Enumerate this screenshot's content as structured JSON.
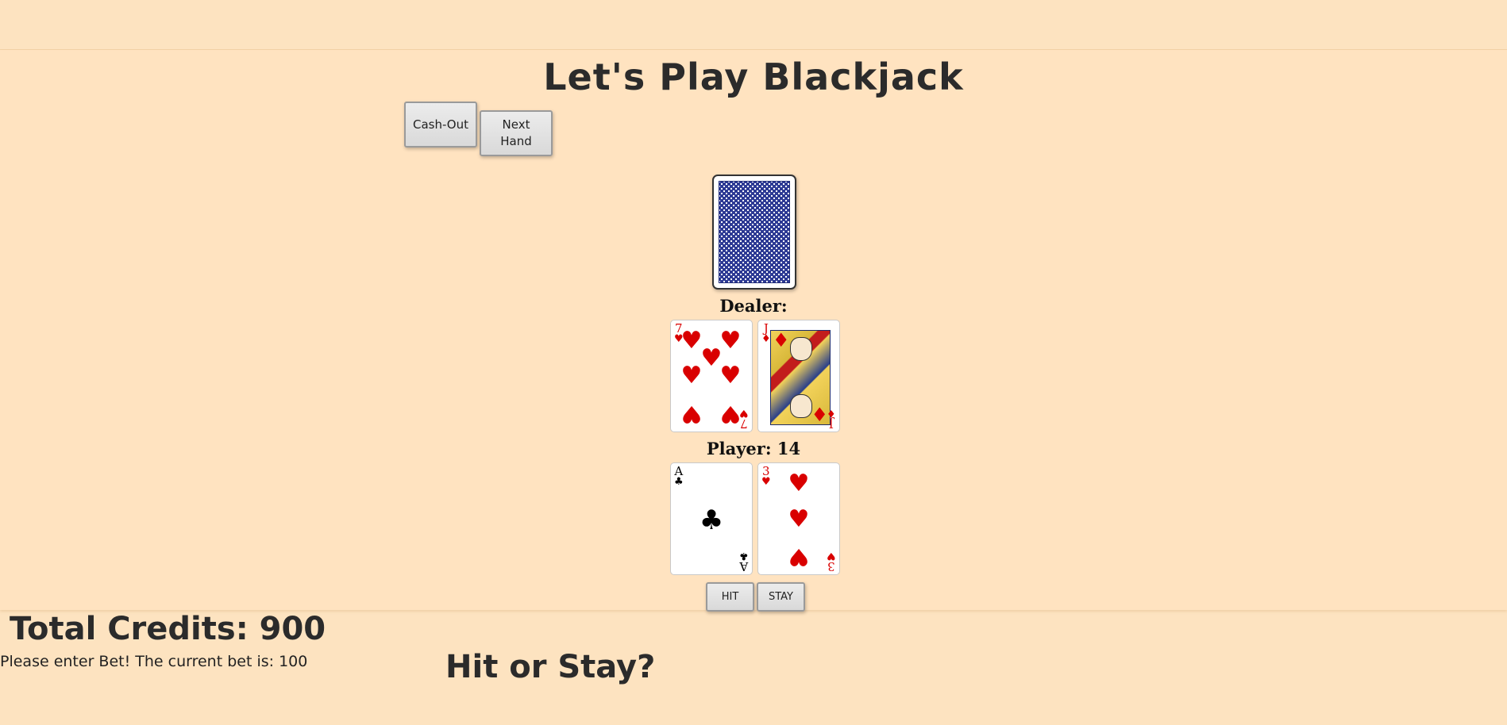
{
  "title": "Let's Play Blackjack",
  "buttons": {
    "cash_out": "Cash-Out",
    "next_hand_line1": "Next",
    "next_hand_line2": "Hand",
    "hit": "HIT",
    "stay": "STAY"
  },
  "dealer": {
    "label": "Dealer:",
    "hidden_card": "card-back",
    "cards": [
      {
        "rank": "7",
        "suit": "♥",
        "color": "#d90000"
      },
      {
        "rank": "J",
        "suit": "♦",
        "color": "#d90000"
      }
    ]
  },
  "player": {
    "label": "Player: 14",
    "cards": [
      {
        "rank": "A",
        "suit": "♣",
        "color": "#000000"
      },
      {
        "rank": "3",
        "suit": "♥",
        "color": "#d90000"
      }
    ]
  },
  "status": {
    "credits": "Total Credits: 900",
    "bet_message": "Please enter Bet! The current bet is: 100",
    "prompt": "Hit or Stay?"
  },
  "colors": {
    "background": "#fde3c0",
    "heart_diamond": "#d90000",
    "card_back": "#2d3a94"
  }
}
